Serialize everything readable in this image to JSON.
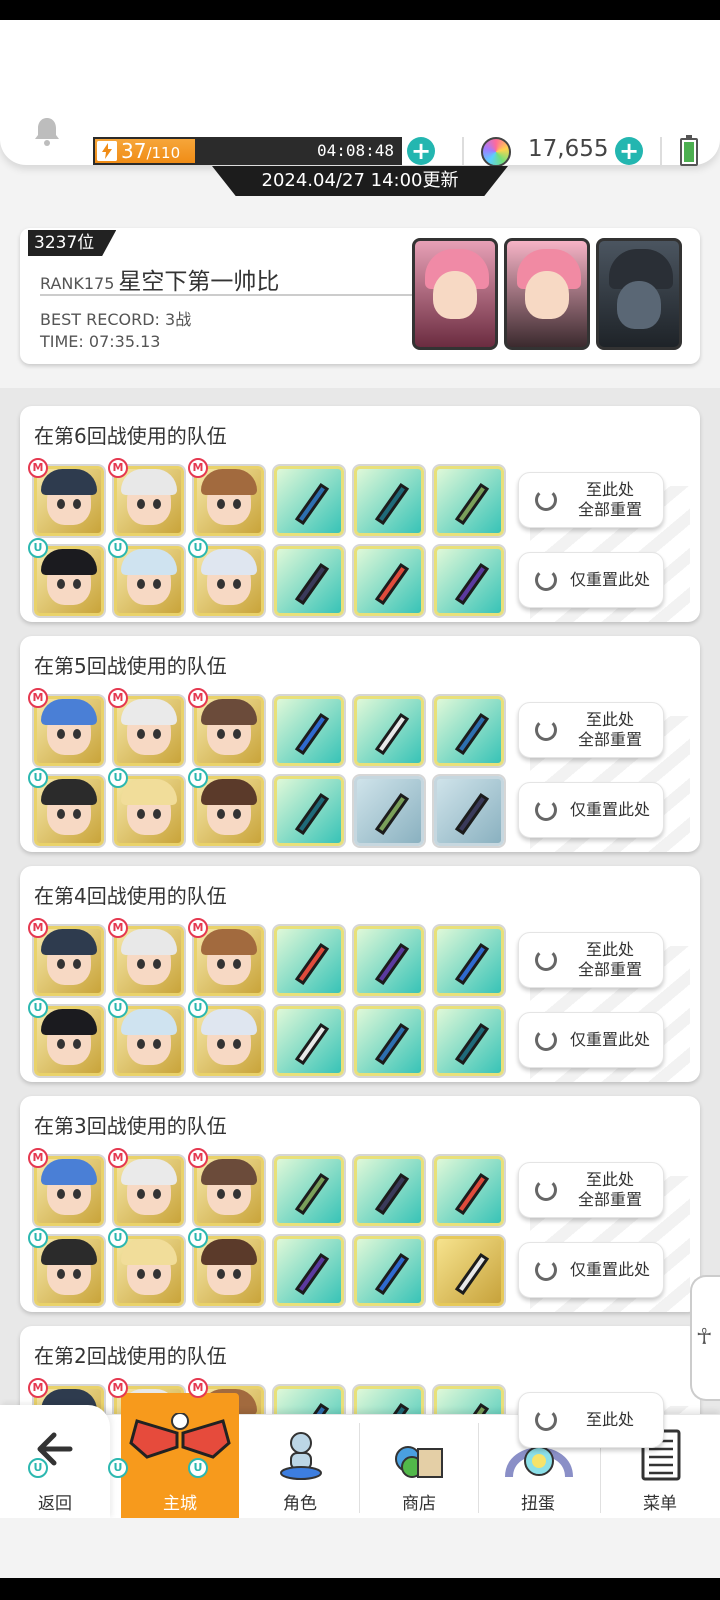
{
  "header": {
    "energy_current": "37",
    "energy_max": "/110",
    "energy_timer": "04:08:48",
    "gem_count": "17,655"
  },
  "update_banner": "2024.04/27 14:00更新",
  "rank": {
    "position": "3237位",
    "level": "RANK175",
    "player_name": "星空下第一帅比",
    "best_record": "BEST RECORD: 3战",
    "time": "TIME: 07:35.13"
  },
  "teams": [
    {
      "title": "在第6回战使用的队伍",
      "reset_all_label": "至此处\n全部重置",
      "reset_this_label": "仅重置此处"
    },
    {
      "title": "在第5回战使用的队伍",
      "reset_all_label": "至此处\n全部重置",
      "reset_this_label": "仅重置此处"
    },
    {
      "title": "在第4回战使用的队伍",
      "reset_all_label": "至此处\n全部重置",
      "reset_this_label": "仅重置此处"
    },
    {
      "title": "在第3回战使用的队伍",
      "reset_all_label": "至此处\n全部重置",
      "reset_this_label": "仅重置此处"
    },
    {
      "title": "在第2回战使用的队伍",
      "reset_all_label": "至此处"
    }
  ],
  "badges": {
    "main": "M",
    "sub": "U"
  },
  "nav": {
    "back": "返回",
    "main_city": "主城",
    "characters": "角色",
    "shop": "商店",
    "gacha": "扭蛋",
    "menu": "菜单"
  },
  "colors": {
    "accent_teal": "#23b6b0",
    "nav_active": "#f79a1c",
    "energy_orange": "#f08c16",
    "main_badge": "#e53950"
  }
}
